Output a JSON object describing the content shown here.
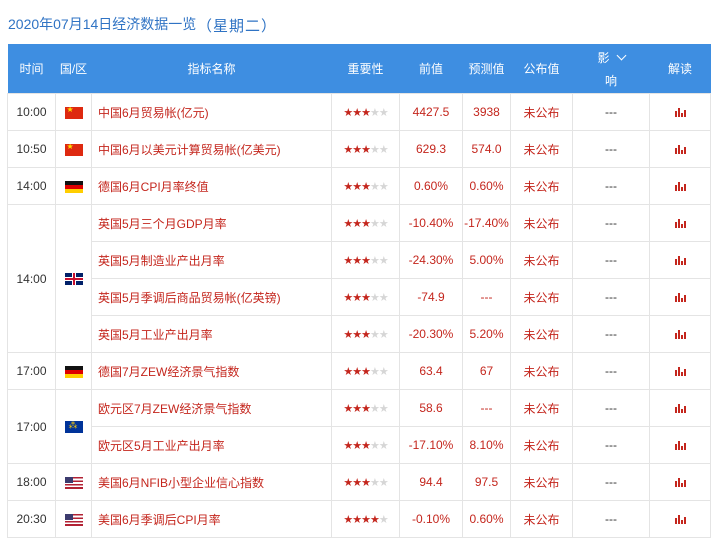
{
  "header": {
    "date_title": "2020年07月14日经济数据一览",
    "weekday": "（星期二）"
  },
  "columns": {
    "time": "时间",
    "country": "国/区",
    "indicator": "指标名称",
    "importance": "重要性",
    "previous": "前值",
    "forecast": "预测值",
    "published": "公布值",
    "impact_top": "影",
    "impact_bottom": "响",
    "analysis": "解读"
  },
  "rows": [
    {
      "time": "10:00",
      "flag": "china-flag-icon",
      "name": "中国6月贸易帐(亿元)",
      "stars": 3,
      "previous": "4427.5",
      "forecast": "3938",
      "published": "未公布",
      "impact": "---"
    },
    {
      "time": "10:50",
      "flag": "china-flag-icon",
      "name": "中国6月以美元计算贸易帐(亿美元)",
      "stars": 3,
      "previous": "629.3",
      "forecast": "574.0",
      "published": "未公布",
      "impact": "---"
    },
    {
      "time": "14:00",
      "flag": "germany-flag-icon",
      "name": "德国6月CPI月率终值",
      "stars": 3,
      "previous": "0.60%",
      "forecast": "0.60%",
      "published": "未公布",
      "impact": "---"
    },
    {
      "time": "14:00",
      "flag": "uk-flag-icon",
      "name": "英国5月三个月GDP月率",
      "stars": 3,
      "previous": "-10.40%",
      "forecast": "-17.40%",
      "published": "未公布",
      "impact": "---"
    },
    {
      "time": "",
      "flag": "",
      "name": "英国5月制造业产出月率",
      "stars": 3,
      "previous": "-24.30%",
      "forecast": "5.00%",
      "published": "未公布",
      "impact": "---"
    },
    {
      "time": "",
      "flag": "",
      "name": "英国5月季调后商品贸易帐(亿英镑)",
      "stars": 3,
      "previous": "-74.9",
      "forecast": "---",
      "published": "未公布",
      "impact": "---"
    },
    {
      "time": "",
      "flag": "",
      "name": "英国5月工业产出月率",
      "stars": 3,
      "previous": "-20.30%",
      "forecast": "5.20%",
      "published": "未公布",
      "impact": "---"
    },
    {
      "time": "17:00",
      "flag": "germany-flag-icon",
      "name": "德国7月ZEW经济景气指数",
      "stars": 3,
      "previous": "63.4",
      "forecast": "67",
      "published": "未公布",
      "impact": "---"
    },
    {
      "time": "17:00",
      "flag": "eu-flag-icon",
      "name": "欧元区7月ZEW经济景气指数",
      "stars": 3,
      "previous": "58.6",
      "forecast": "---",
      "published": "未公布",
      "impact": "---"
    },
    {
      "time": "",
      "flag": "",
      "name": "欧元区5月工业产出月率",
      "stars": 3,
      "previous": "-17.10%",
      "forecast": "8.10%",
      "published": "未公布",
      "impact": "---"
    },
    {
      "time": "18:00",
      "flag": "us-flag-icon",
      "name": "美国6月NFIB小型企业信心指数",
      "stars": 3,
      "previous": "94.4",
      "forecast": "97.5",
      "published": "未公布",
      "impact": "---"
    },
    {
      "time": "20:30",
      "flag": "us-flag-icon",
      "name": "美国6月季调后CPI月率",
      "stars": 4,
      "previous": "-0.10%",
      "forecast": "0.60%",
      "published": "未公布",
      "impact": "---"
    }
  ],
  "colors": {
    "header_bg": "#3e8ee1",
    "accent_red": "#c4261d",
    "title_blue": "#2f73c4"
  }
}
